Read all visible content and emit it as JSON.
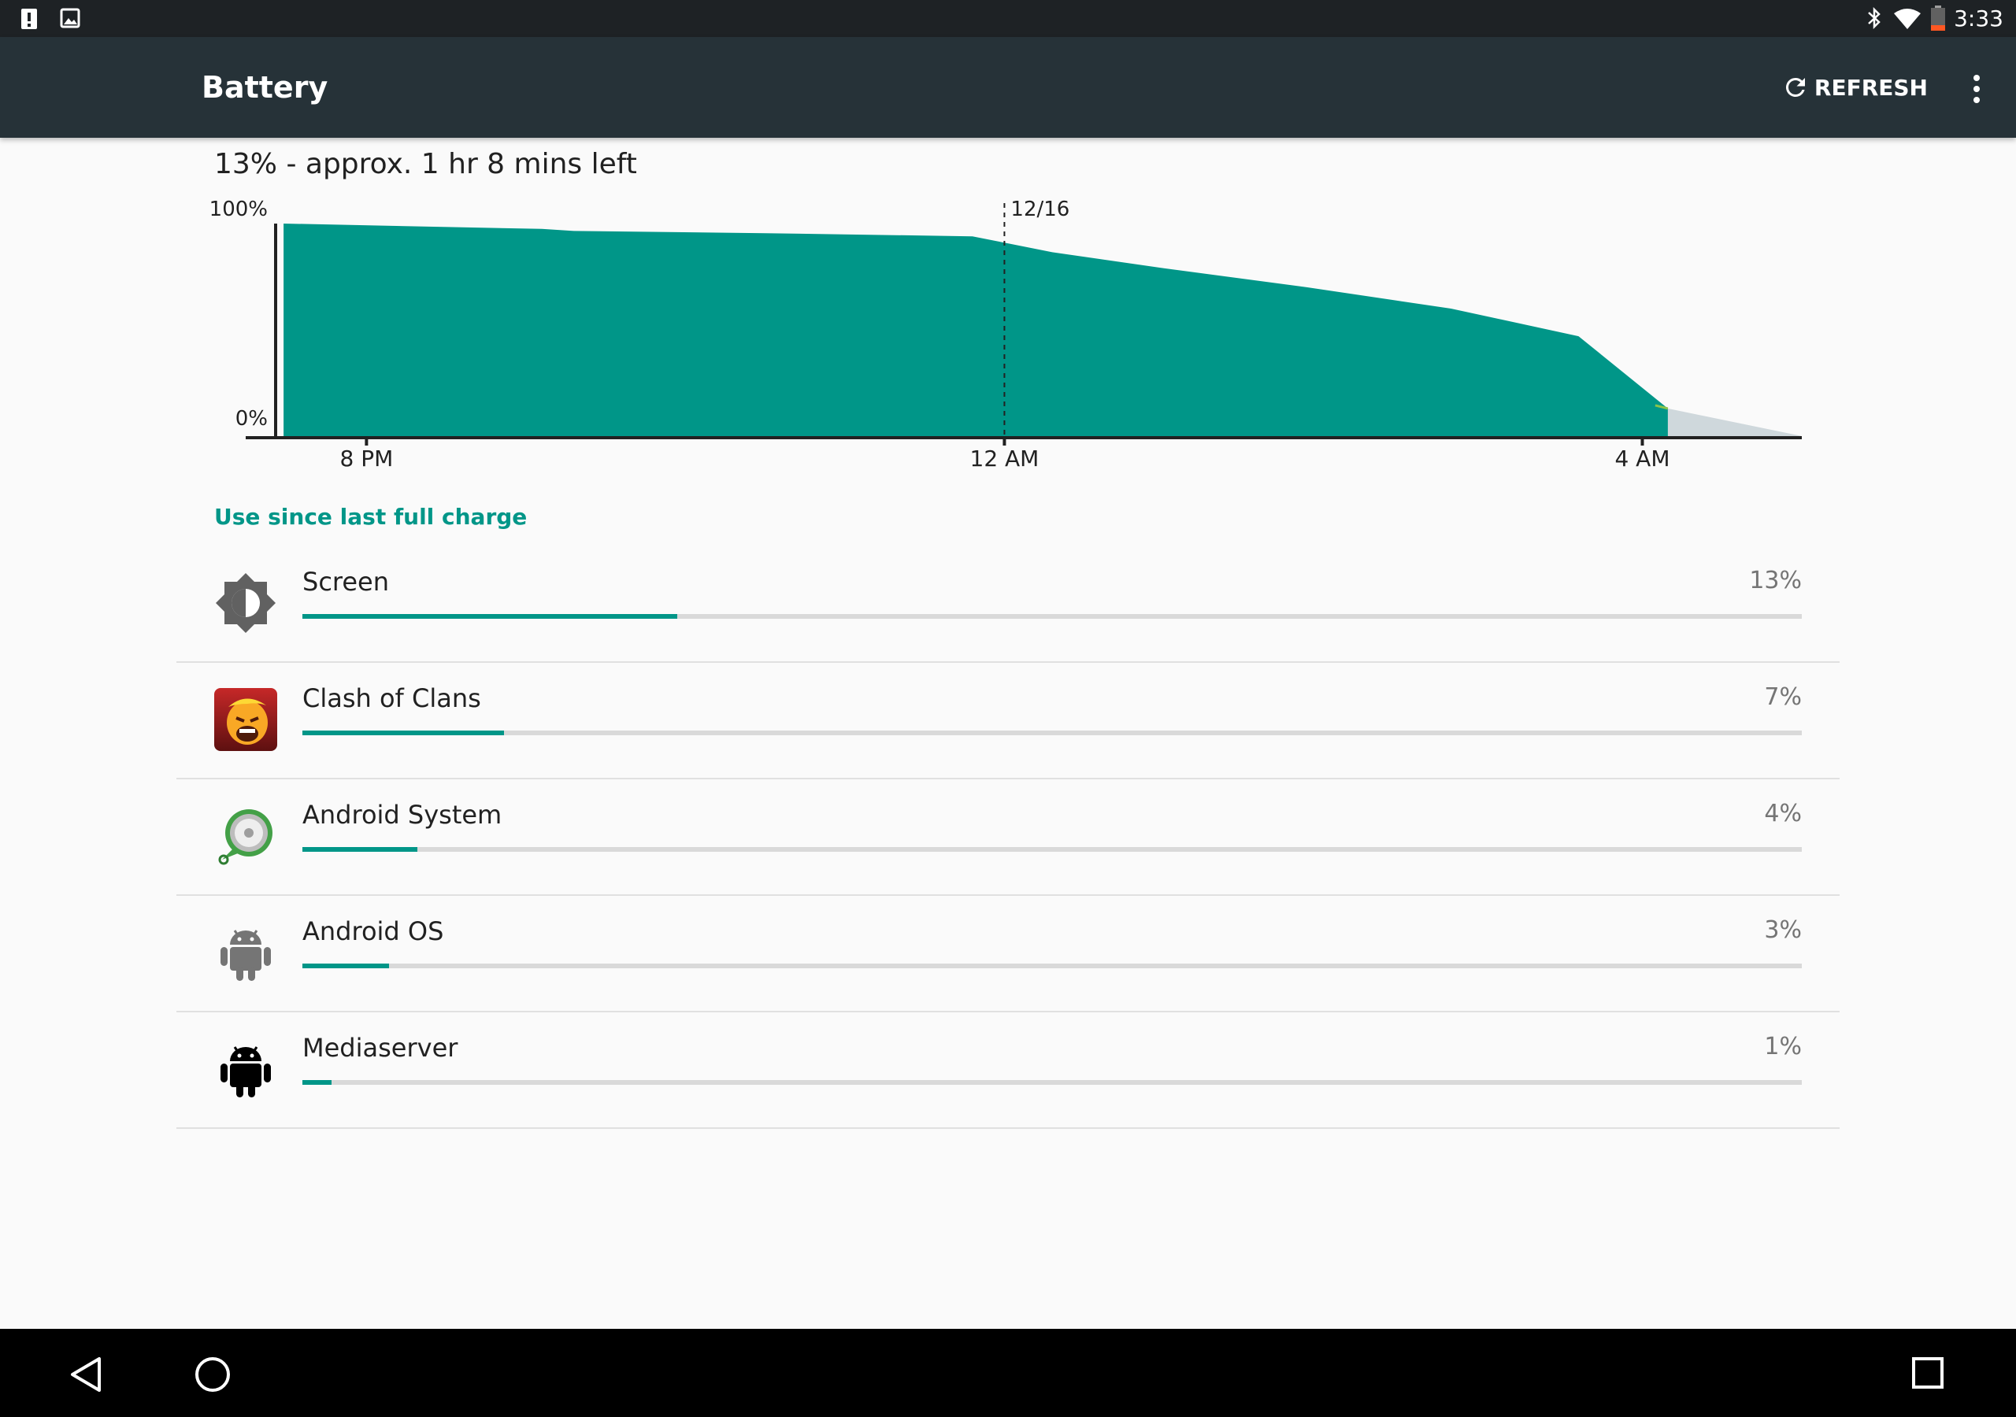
{
  "status_bar": {
    "time": "3:33",
    "left_icons": [
      "alert-icon",
      "image-icon"
    ],
    "right_icons": [
      "bluetooth-icon",
      "wifi-icon",
      "battery-low-icon"
    ]
  },
  "app_bar": {
    "title": "Battery",
    "refresh_label": "REFRESH",
    "overflow_icon": "more-vert-icon"
  },
  "summary": "13% - approx. 1 hr 8 mins left",
  "chart_data": {
    "type": "area",
    "y_labels": [
      "100%",
      "0%"
    ],
    "ylim": [
      0,
      100
    ],
    "x_ticks": [
      {
        "label": "8 PM",
        "x": 20
      },
      {
        "label": "12 AM",
        "x": 24
      },
      {
        "label": "4 AM",
        "x": 28
      }
    ],
    "xlim": [
      19.45,
      29.0
    ],
    "date_marker": {
      "label": "12/16",
      "x": 24
    },
    "series": [
      {
        "values": [
          [
            19.48,
            100
          ],
          [
            21.1,
            97.5
          ],
          [
            21.3,
            96.5
          ],
          [
            22.5,
            95.5
          ],
          [
            23.8,
            94
          ],
          [
            24.0,
            91
          ],
          [
            24.3,
            86.5
          ],
          [
            25.0,
            79
          ],
          [
            25.9,
            70
          ],
          [
            26.8,
            60
          ],
          [
            27.6,
            47
          ],
          [
            28.16,
            13
          ]
        ]
      }
    ],
    "projection": {
      "start": [
        28.16,
        13
      ],
      "end": [
        29.0,
        0
      ]
    },
    "colors": {
      "area": "#009688",
      "projection": "#cfd8dc",
      "current": "#8bc34a"
    }
  },
  "section_title": "Use since last full charge",
  "items": [
    {
      "name": "Screen",
      "percent_label": "13%",
      "percent": 13,
      "icon": "brightness-icon"
    },
    {
      "name": "Clash of Clans",
      "percent_label": "7%",
      "percent": 7,
      "icon": "clash-of-clans-icon"
    },
    {
      "name": "Android System",
      "percent_label": "4%",
      "percent": 4,
      "icon": "android-system-icon"
    },
    {
      "name": "Android OS",
      "percent_label": "3%",
      "percent": 3,
      "icon": "android-os-icon"
    },
    {
      "name": "Mediaserver",
      "percent_label": "1%",
      "percent": 1,
      "icon": "mediaserver-icon"
    }
  ],
  "nav_bar": {
    "icons": [
      "back-icon",
      "home-icon",
      "recents-icon"
    ]
  },
  "colors": {
    "accent": "#009688",
    "app_bar": "#263238",
    "status_bar": "#1e2225"
  }
}
